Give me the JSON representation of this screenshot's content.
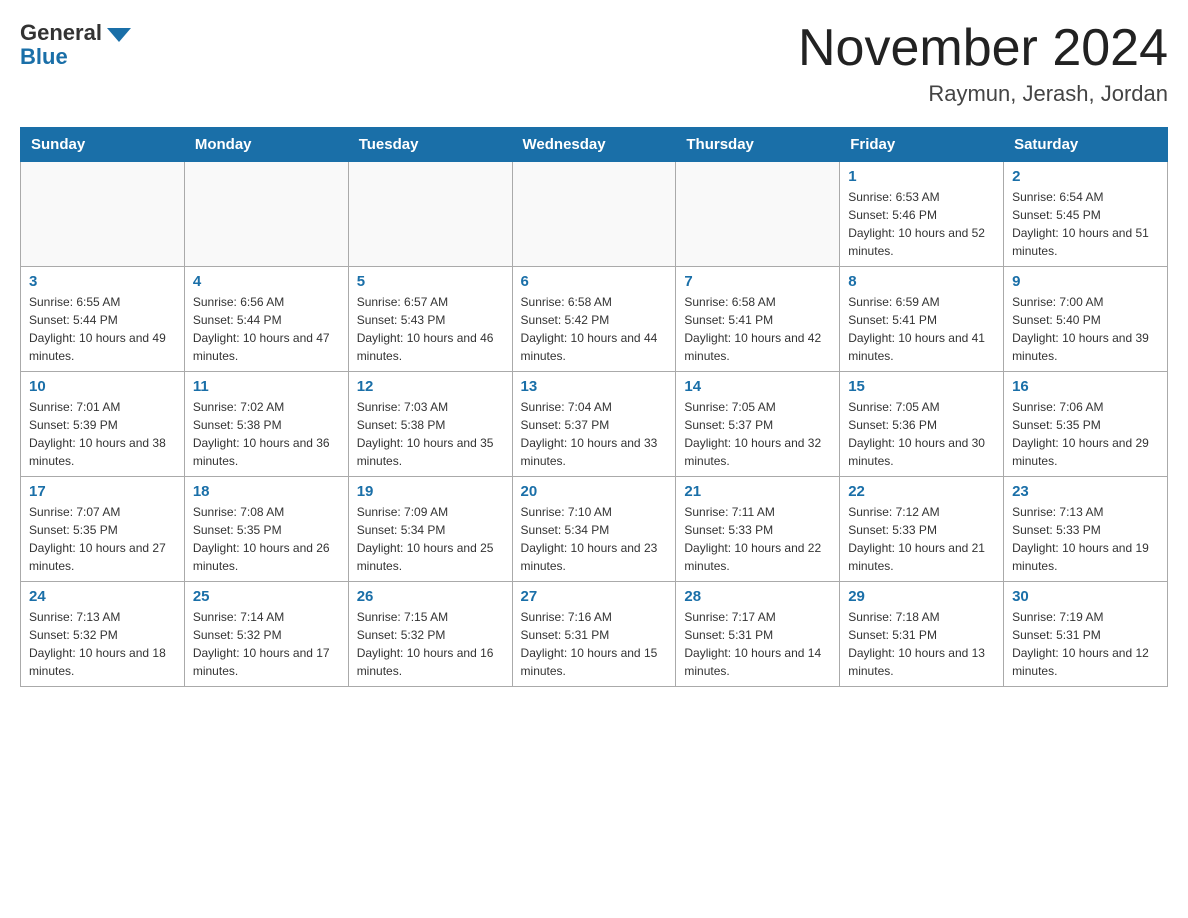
{
  "logo": {
    "general": "General",
    "blue": "Blue"
  },
  "title": "November 2024",
  "subtitle": "Raymun, Jerash, Jordan",
  "days_of_week": [
    "Sunday",
    "Monday",
    "Tuesday",
    "Wednesday",
    "Thursday",
    "Friday",
    "Saturday"
  ],
  "weeks": [
    [
      {
        "day": "",
        "sunrise": "",
        "sunset": "",
        "daylight": ""
      },
      {
        "day": "",
        "sunrise": "",
        "sunset": "",
        "daylight": ""
      },
      {
        "day": "",
        "sunrise": "",
        "sunset": "",
        "daylight": ""
      },
      {
        "day": "",
        "sunrise": "",
        "sunset": "",
        "daylight": ""
      },
      {
        "day": "",
        "sunrise": "",
        "sunset": "",
        "daylight": ""
      },
      {
        "day": "1",
        "sunrise": "Sunrise: 6:53 AM",
        "sunset": "Sunset: 5:46 PM",
        "daylight": "Daylight: 10 hours and 52 minutes."
      },
      {
        "day": "2",
        "sunrise": "Sunrise: 6:54 AM",
        "sunset": "Sunset: 5:45 PM",
        "daylight": "Daylight: 10 hours and 51 minutes."
      }
    ],
    [
      {
        "day": "3",
        "sunrise": "Sunrise: 6:55 AM",
        "sunset": "Sunset: 5:44 PM",
        "daylight": "Daylight: 10 hours and 49 minutes."
      },
      {
        "day": "4",
        "sunrise": "Sunrise: 6:56 AM",
        "sunset": "Sunset: 5:44 PM",
        "daylight": "Daylight: 10 hours and 47 minutes."
      },
      {
        "day": "5",
        "sunrise": "Sunrise: 6:57 AM",
        "sunset": "Sunset: 5:43 PM",
        "daylight": "Daylight: 10 hours and 46 minutes."
      },
      {
        "day": "6",
        "sunrise": "Sunrise: 6:58 AM",
        "sunset": "Sunset: 5:42 PM",
        "daylight": "Daylight: 10 hours and 44 minutes."
      },
      {
        "day": "7",
        "sunrise": "Sunrise: 6:58 AM",
        "sunset": "Sunset: 5:41 PM",
        "daylight": "Daylight: 10 hours and 42 minutes."
      },
      {
        "day": "8",
        "sunrise": "Sunrise: 6:59 AM",
        "sunset": "Sunset: 5:41 PM",
        "daylight": "Daylight: 10 hours and 41 minutes."
      },
      {
        "day": "9",
        "sunrise": "Sunrise: 7:00 AM",
        "sunset": "Sunset: 5:40 PM",
        "daylight": "Daylight: 10 hours and 39 minutes."
      }
    ],
    [
      {
        "day": "10",
        "sunrise": "Sunrise: 7:01 AM",
        "sunset": "Sunset: 5:39 PM",
        "daylight": "Daylight: 10 hours and 38 minutes."
      },
      {
        "day": "11",
        "sunrise": "Sunrise: 7:02 AM",
        "sunset": "Sunset: 5:38 PM",
        "daylight": "Daylight: 10 hours and 36 minutes."
      },
      {
        "day": "12",
        "sunrise": "Sunrise: 7:03 AM",
        "sunset": "Sunset: 5:38 PM",
        "daylight": "Daylight: 10 hours and 35 minutes."
      },
      {
        "day": "13",
        "sunrise": "Sunrise: 7:04 AM",
        "sunset": "Sunset: 5:37 PM",
        "daylight": "Daylight: 10 hours and 33 minutes."
      },
      {
        "day": "14",
        "sunrise": "Sunrise: 7:05 AM",
        "sunset": "Sunset: 5:37 PM",
        "daylight": "Daylight: 10 hours and 32 minutes."
      },
      {
        "day": "15",
        "sunrise": "Sunrise: 7:05 AM",
        "sunset": "Sunset: 5:36 PM",
        "daylight": "Daylight: 10 hours and 30 minutes."
      },
      {
        "day": "16",
        "sunrise": "Sunrise: 7:06 AM",
        "sunset": "Sunset: 5:35 PM",
        "daylight": "Daylight: 10 hours and 29 minutes."
      }
    ],
    [
      {
        "day": "17",
        "sunrise": "Sunrise: 7:07 AM",
        "sunset": "Sunset: 5:35 PM",
        "daylight": "Daylight: 10 hours and 27 minutes."
      },
      {
        "day": "18",
        "sunrise": "Sunrise: 7:08 AM",
        "sunset": "Sunset: 5:35 PM",
        "daylight": "Daylight: 10 hours and 26 minutes."
      },
      {
        "day": "19",
        "sunrise": "Sunrise: 7:09 AM",
        "sunset": "Sunset: 5:34 PM",
        "daylight": "Daylight: 10 hours and 25 minutes."
      },
      {
        "day": "20",
        "sunrise": "Sunrise: 7:10 AM",
        "sunset": "Sunset: 5:34 PM",
        "daylight": "Daylight: 10 hours and 23 minutes."
      },
      {
        "day": "21",
        "sunrise": "Sunrise: 7:11 AM",
        "sunset": "Sunset: 5:33 PM",
        "daylight": "Daylight: 10 hours and 22 minutes."
      },
      {
        "day": "22",
        "sunrise": "Sunrise: 7:12 AM",
        "sunset": "Sunset: 5:33 PM",
        "daylight": "Daylight: 10 hours and 21 minutes."
      },
      {
        "day": "23",
        "sunrise": "Sunrise: 7:13 AM",
        "sunset": "Sunset: 5:33 PM",
        "daylight": "Daylight: 10 hours and 19 minutes."
      }
    ],
    [
      {
        "day": "24",
        "sunrise": "Sunrise: 7:13 AM",
        "sunset": "Sunset: 5:32 PM",
        "daylight": "Daylight: 10 hours and 18 minutes."
      },
      {
        "day": "25",
        "sunrise": "Sunrise: 7:14 AM",
        "sunset": "Sunset: 5:32 PM",
        "daylight": "Daylight: 10 hours and 17 minutes."
      },
      {
        "day": "26",
        "sunrise": "Sunrise: 7:15 AM",
        "sunset": "Sunset: 5:32 PM",
        "daylight": "Daylight: 10 hours and 16 minutes."
      },
      {
        "day": "27",
        "sunrise": "Sunrise: 7:16 AM",
        "sunset": "Sunset: 5:31 PM",
        "daylight": "Daylight: 10 hours and 15 minutes."
      },
      {
        "day": "28",
        "sunrise": "Sunrise: 7:17 AM",
        "sunset": "Sunset: 5:31 PM",
        "daylight": "Daylight: 10 hours and 14 minutes."
      },
      {
        "day": "29",
        "sunrise": "Sunrise: 7:18 AM",
        "sunset": "Sunset: 5:31 PM",
        "daylight": "Daylight: 10 hours and 13 minutes."
      },
      {
        "day": "30",
        "sunrise": "Sunrise: 7:19 AM",
        "sunset": "Sunset: 5:31 PM",
        "daylight": "Daylight: 10 hours and 12 minutes."
      }
    ]
  ]
}
